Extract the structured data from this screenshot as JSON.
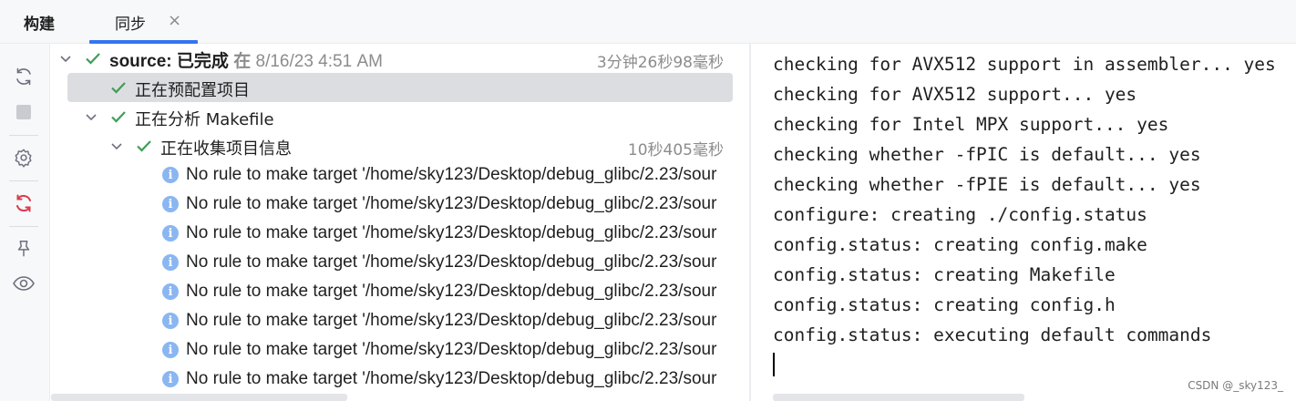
{
  "tabs": {
    "build_label": "构建",
    "sync_label": "同步",
    "close_glyph": "×"
  },
  "toolbar": {
    "icons": [
      "refresh-icon",
      "stop-icon",
      "settings-icon",
      "sync-error-icon",
      "pin-icon",
      "eye-icon"
    ]
  },
  "tree": {
    "root": {
      "name": "source:",
      "status": "已完成",
      "at": "在",
      "timestamp": "8/16/23 4:51 AM",
      "duration": "3分钟26秒98毫秒"
    },
    "items": [
      {
        "label": "正在预配置项目"
      },
      {
        "label": "正在分析 Makefile"
      },
      {
        "label": "正在收集项目信息",
        "duration": "10秒405毫秒"
      }
    ],
    "messages": [
      "No rule to make target '/home/sky123/Desktop/debug_glibc/2.23/sour",
      "No rule to make target '/home/sky123/Desktop/debug_glibc/2.23/sour",
      "No rule to make target '/home/sky123/Desktop/debug_glibc/2.23/sour",
      "No rule to make target '/home/sky123/Desktop/debug_glibc/2.23/sour",
      "No rule to make target '/home/sky123/Desktop/debug_glibc/2.23/sour",
      "No rule to make target '/home/sky123/Desktop/debug_glibc/2.23/sour",
      "No rule to make target '/home/sky123/Desktop/debug_glibc/2.23/sour",
      "No rule to make target '/home/sky123/Desktop/debug_glibc/2.23/sour"
    ]
  },
  "console": {
    "lines": [
      "checking for AVX512 support in assembler... yes",
      "checking for AVX512 support... yes",
      "checking for Intel MPX support... yes",
      "checking whether -fPIC is default... yes",
      "checking whether -fPIE is default... yes",
      "configure: creating ./config.status",
      "config.status: creating config.make",
      "config.status: creating Makefile",
      "config.status: creating config.h",
      "config.status: executing default commands"
    ]
  },
  "watermark": "CSDN @_sky123_",
  "colors": {
    "accent": "#3574f0",
    "success": "#3f9e57",
    "info": "#8ab6f2",
    "error": "#db3b4b"
  }
}
